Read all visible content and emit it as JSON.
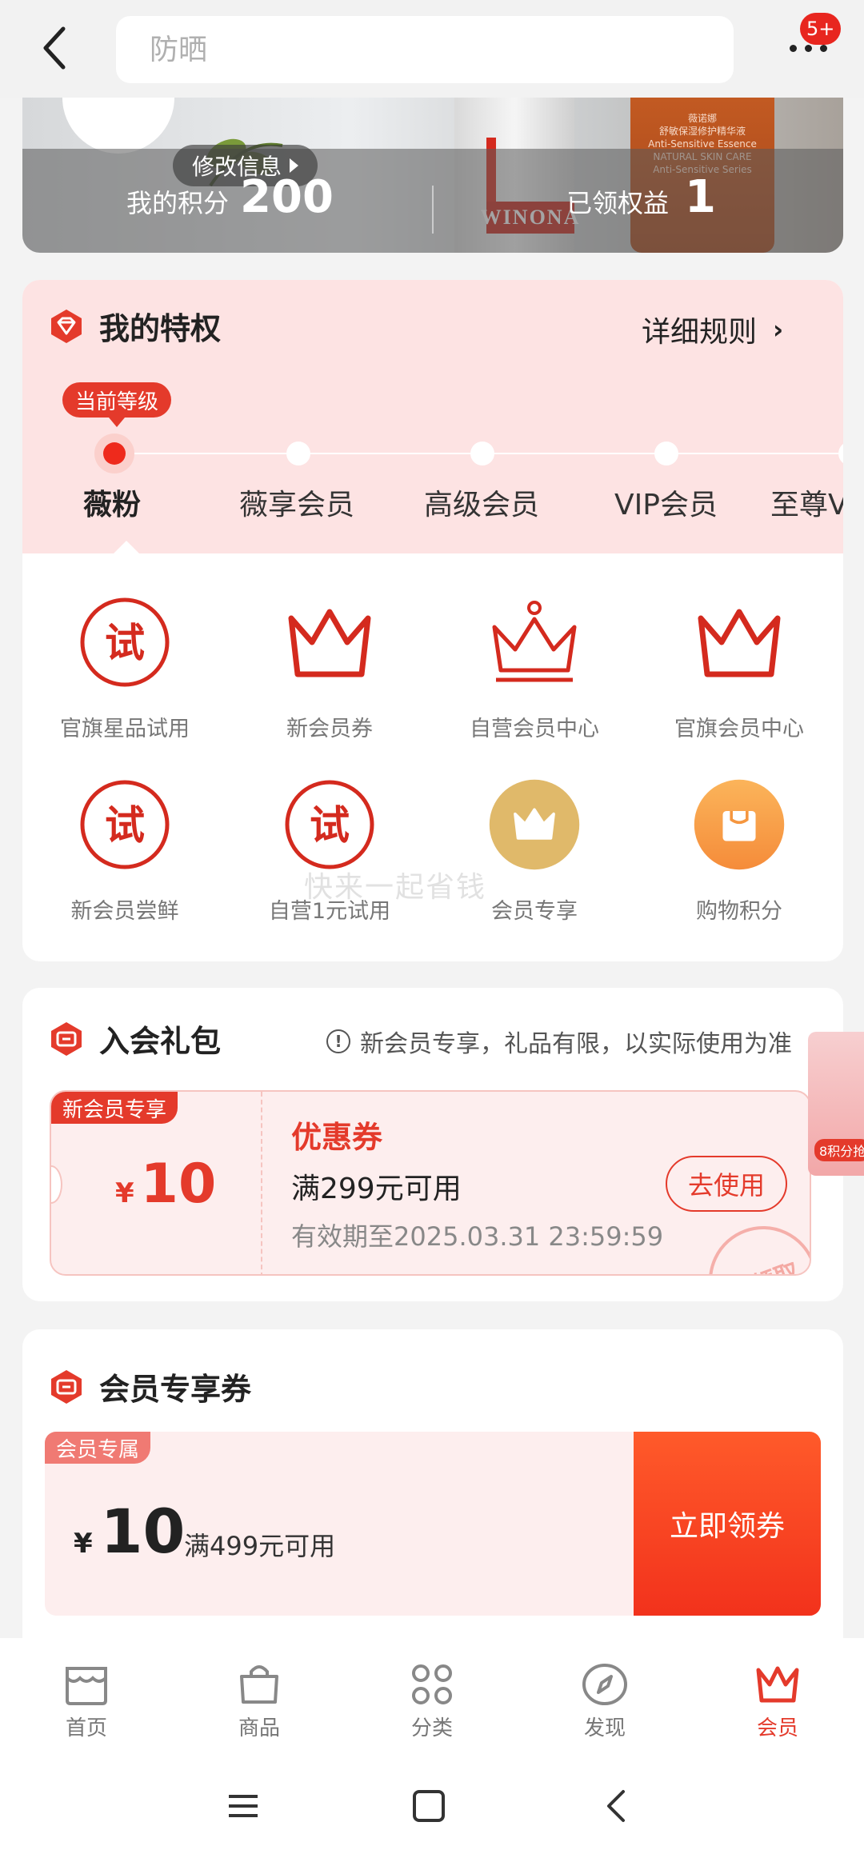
{
  "search": {
    "placeholder": "防晒"
  },
  "notifications": {
    "badge": "5+"
  },
  "banner": {
    "modify_info": "修改信息",
    "points_label": "我的积分",
    "points_value": "200",
    "rights_label": "已领权益",
    "rights_value": "1",
    "brand_text": "WINONA",
    "product_label": "薇诺娜 舒敏保湿修护精华液 Anti-Sensitive Essence NATURAL SKIN CARE Anti-Sensitive Series"
  },
  "privileges": {
    "title": "我的特权",
    "rules_label": "详细规则",
    "current_level_tag": "当前等级",
    "levels": [
      "薇粉",
      "薇享会员",
      "高级会员",
      "VIP会员",
      "至尊VIP会员"
    ],
    "items": [
      {
        "label": "官旗星品试用",
        "icon": "trial-icon"
      },
      {
        "label": "新会员券",
        "icon": "crown-icon"
      },
      {
        "label": "自营会员中心",
        "icon": "crown-dot-icon"
      },
      {
        "label": "官旗会员中心",
        "icon": "crown-icon"
      },
      {
        "label": "新会员尝鲜",
        "icon": "trial-icon"
      },
      {
        "label": "自营1元试用",
        "icon": "trial-icon"
      },
      {
        "label": "会员专享",
        "icon": "gold-crown-icon"
      },
      {
        "label": "购物积分",
        "icon": "shopping-bag-icon"
      }
    ],
    "trial_char": "试"
  },
  "watermark": "快来一起省钱",
  "gift": {
    "title": "入会礼包",
    "note": "新会员专享，礼品有限，以实际使用为准",
    "side_label": "8积分抢",
    "coupon": {
      "tag": "新会员专享",
      "currency": "¥",
      "amount": "10",
      "type": "优惠券",
      "condition": "满299元可用",
      "validity": "有效期至2025.03.31 23:59:59",
      "button": "去使用",
      "stamp": "已领取"
    }
  },
  "member_coupon": {
    "title": "会员专享券",
    "tag": "会员专属",
    "currency": "¥",
    "amount": "10",
    "condition": "满499元可用",
    "button": "立即领券"
  },
  "tabbar": [
    {
      "label": "首页",
      "icon": "home-store-icon",
      "active": false
    },
    {
      "label": "商品",
      "icon": "shopping-bag-icon",
      "active": false
    },
    {
      "label": "分类",
      "icon": "category-icon",
      "active": false
    },
    {
      "label": "发现",
      "icon": "compass-icon",
      "active": false
    },
    {
      "label": "会员",
      "icon": "crown-icon",
      "active": true
    }
  ],
  "colors": {
    "accent": "#e43a2b",
    "pink_bg": "#fde3e3",
    "gold": "#e0b96a",
    "orange": "#f7a24a"
  }
}
